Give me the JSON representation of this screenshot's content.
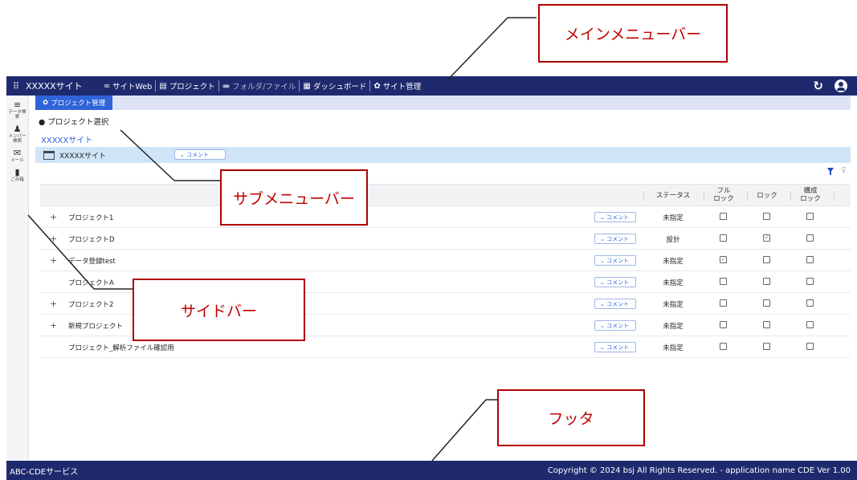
{
  "annotations": {
    "main_menu": "メインメニューバー",
    "sub_menu": "サブメニューバー",
    "sidebar": "サイドバー",
    "footer": "フッタ"
  },
  "topbar": {
    "site_title": "XXXXXサイト",
    "nav": [
      {
        "label": "サイトWeb",
        "icon": "link-icon"
      },
      {
        "label": "プロジェクト",
        "icon": "archive-icon"
      },
      {
        "label": "フォルダ/ファイル",
        "icon": "folder-icon"
      },
      {
        "label": "ダッシュボード",
        "icon": "dashboard-icon"
      },
      {
        "label": "サイト管理",
        "icon": "gear-icon"
      }
    ],
    "refresh_icon": "refresh-icon",
    "user_icon": "user-icon"
  },
  "sidebar": {
    "items": [
      {
        "label": "データ検索",
        "icon": "data-search-icon"
      },
      {
        "label": "メンバー検索",
        "icon": "member-search-icon"
      },
      {
        "label": "メール",
        "icon": "mail-icon"
      },
      {
        "label": "ごみ箱",
        "icon": "trash-icon"
      }
    ]
  },
  "tab": {
    "label": "プロジェクト管理"
  },
  "subhead": "● プロジェクト選択",
  "site_link": "XXXXXサイト",
  "site_row": {
    "name": "XXXXXサイト",
    "comment": "コメント"
  },
  "table": {
    "headers": {
      "status": "ステータス",
      "full_lock": "フル\nロック",
      "lock": "ロック",
      "config_lock": "構成\nロック"
    },
    "comment_label": "コメント",
    "rows": [
      {
        "expand": "+",
        "name": "プロジェクト1",
        "status": "未指定",
        "full_lock": false,
        "lock": false,
        "config_lock": false
      },
      {
        "expand": "+",
        "name": "プロジェクトD",
        "status": "設計",
        "full_lock": false,
        "lock": true,
        "config_lock": false
      },
      {
        "expand": "+",
        "name": "データ登録test",
        "status": "未指定",
        "full_lock": true,
        "lock": false,
        "config_lock": false
      },
      {
        "expand": "",
        "name": "プロジェクトA",
        "status": "未指定",
        "full_lock": false,
        "lock": false,
        "config_lock": false
      },
      {
        "expand": "+",
        "name": "プロジェクト2",
        "status": "未指定",
        "full_lock": false,
        "lock": false,
        "config_lock": false
      },
      {
        "expand": "+",
        "name": "新規プロジェクト",
        "status": "未指定",
        "full_lock": false,
        "lock": false,
        "config_lock": false
      },
      {
        "expand": "",
        "name": "プロジェクト_解析ファイル確認用",
        "status": "未指定",
        "full_lock": false,
        "lock": false,
        "config_lock": false
      }
    ]
  },
  "footer": {
    "left": "ABC-CDEサービス",
    "right": "Copyright © 2024 bsj All Rights Reserved. - application name CDE Ver 1.00"
  },
  "colors": {
    "navy": "#1f2a6e",
    "accent": "#2f63d8",
    "annotation": "#c00000",
    "site_row": "#cfe4f7"
  }
}
